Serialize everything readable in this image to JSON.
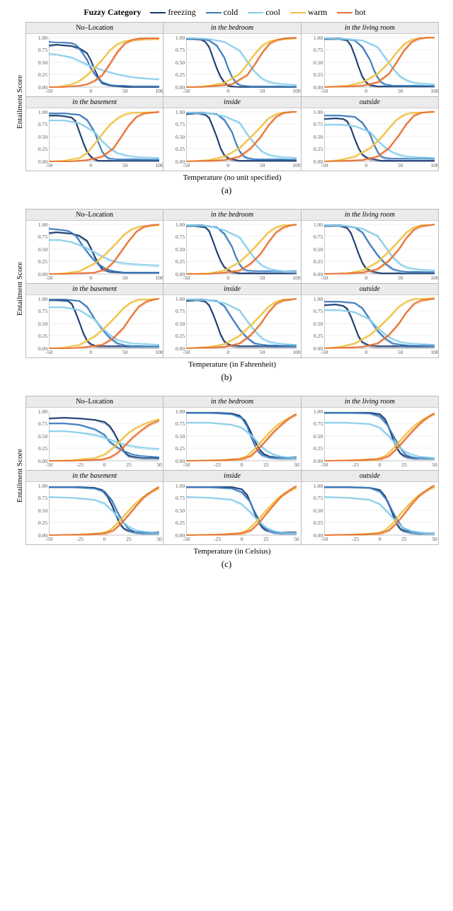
{
  "legend": {
    "title": "Fuzzy Category",
    "items": [
      {
        "label": "freezing",
        "color": "#1a3a6e"
      },
      {
        "label": "cold",
        "color": "#3a7abd"
      },
      {
        "label": "cool",
        "color": "#87ceeb"
      },
      {
        "label": "warm",
        "color": "#f0c040"
      },
      {
        "label": "hot",
        "color": "#e87030"
      }
    ]
  },
  "sections": [
    {
      "id": "a",
      "label": "(a)",
      "x_axis": "Temperature (no unit specified)",
      "x_range": "-50 to 100",
      "panels": [
        {
          "title": "No–Location",
          "italic": false
        },
        {
          "title": "in the bedroom",
          "italic": true
        },
        {
          "title": "in the living room",
          "italic": true
        },
        {
          "title": "in the basement",
          "italic": true
        },
        {
          "title": "inside",
          "italic": true
        },
        {
          "title": "outside",
          "italic": true
        }
      ]
    },
    {
      "id": "b",
      "label": "(b)",
      "x_axis": "Temperature (in Fahrenheit)",
      "x_range": "-50 to 100",
      "panels": [
        {
          "title": "No–Location",
          "italic": false
        },
        {
          "title": "in the bedroom",
          "italic": true
        },
        {
          "title": "in the living room",
          "italic": true
        },
        {
          "title": "in the basement",
          "italic": true
        },
        {
          "title": "inside",
          "italic": true
        },
        {
          "title": "outside",
          "italic": true
        }
      ]
    },
    {
      "id": "c",
      "label": "(c)",
      "x_axis": "Temperature (in Celsius)",
      "x_range": "-50 to 50",
      "panels": [
        {
          "title": "No–Location",
          "italic": false
        },
        {
          "title": "in the bedroom",
          "italic": true
        },
        {
          "title": "in the living room",
          "italic": true
        },
        {
          "title": "in the basement",
          "italic": true
        },
        {
          "title": "inside",
          "italic": true
        },
        {
          "title": "outside",
          "italic": true
        }
      ]
    }
  ],
  "y_axis_label": "Entailment Score",
  "y_ticks": [
    "0.00",
    "0.25",
    "0.50",
    "0.75",
    "1.00"
  ]
}
